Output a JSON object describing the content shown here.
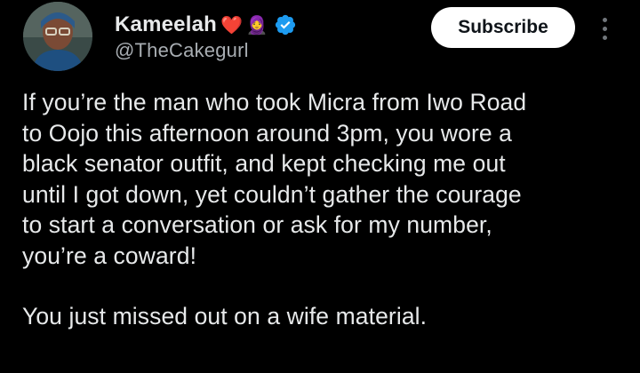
{
  "author": {
    "display_name": "Kameelah",
    "emoji_heart": "❤️",
    "emoji_woman": "🧕",
    "handle": "@TheCakegurl",
    "avatar_icon": "profile-photo",
    "verified_icon": "verified-badge-icon"
  },
  "actions": {
    "subscribe_label": "Subscribe",
    "more_icon": "more-options-icon"
  },
  "tweet": {
    "paragraph_1_lines": [
      "If you’re the man who took Micra from Iwo Road",
      "to Oojo this afternoon around 3pm, you wore a",
      "black senator outfit, and kept checking me out",
      "until I got down, yet couldn’t gather the courage",
      "to start a conversation or ask for my number,",
      "you’re a coward!"
    ],
    "paragraph_2": "You just missed out on a wife material."
  },
  "colors": {
    "background": "#000000",
    "text": "#e7e9ea",
    "secondary_text": "#a8adb2",
    "verified_blue": "#1d9bf0",
    "button_bg": "#ffffff"
  }
}
